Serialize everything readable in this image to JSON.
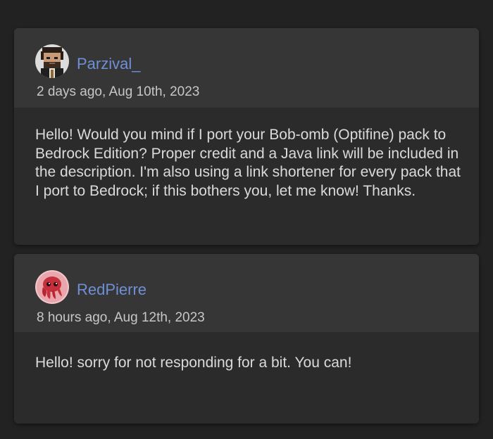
{
  "comments": [
    {
      "username": "Parzival_",
      "timestamp": "2 days ago, Aug 10th, 2023",
      "avatar_icon": "pixel-man-avatar-icon",
      "message": "Hello! Would you mind if I port your Bob-omb (Optifine) pack to Bedrock Edition? Proper credit and a Java link will be included in the description. I'm also using a link shortener for every pack that I port to Bedrock; if this bothers you, let me know! Thanks."
    },
    {
      "username": "RedPierre",
      "timestamp": "8 hours ago, Aug 12th, 2023",
      "avatar_icon": "red-octopus-avatar-icon",
      "message": "Hello! sorry for not responding for a bit. You can!"
    }
  ],
  "colors": {
    "page_background": "#222222",
    "card_background": "#2b2b2b",
    "card_header_background": "#363636",
    "username": "#6f8fd6",
    "timestamp": "#c7c7c7",
    "message_text": "#dadada"
  }
}
